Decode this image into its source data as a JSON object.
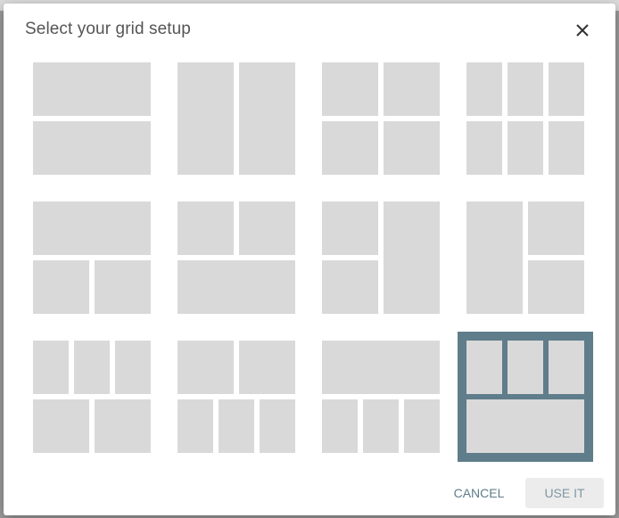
{
  "dialog": {
    "title": "Select your grid setup",
    "close_icon": "close-icon",
    "cancel_label": "CANCEL",
    "use_label": "USE IT",
    "accent_color": "#5f7d8b"
  },
  "layouts": [
    {
      "id": "two-rows",
      "selected": false
    },
    {
      "id": "two-columns",
      "selected": false
    },
    {
      "id": "two-by-two",
      "selected": false
    },
    {
      "id": "three-by-two",
      "selected": false
    },
    {
      "id": "one-top-two-bottom",
      "selected": false
    },
    {
      "id": "two-top-one-bottom",
      "selected": false
    },
    {
      "id": "two-left-one-right",
      "selected": false
    },
    {
      "id": "one-left-two-right",
      "selected": false
    },
    {
      "id": "three-top-two-bottom",
      "selected": false
    },
    {
      "id": "two-top-three-bottom",
      "selected": false
    },
    {
      "id": "one-top-three-bottom",
      "selected": false
    },
    {
      "id": "three-top-one-bottom",
      "selected": true
    }
  ]
}
